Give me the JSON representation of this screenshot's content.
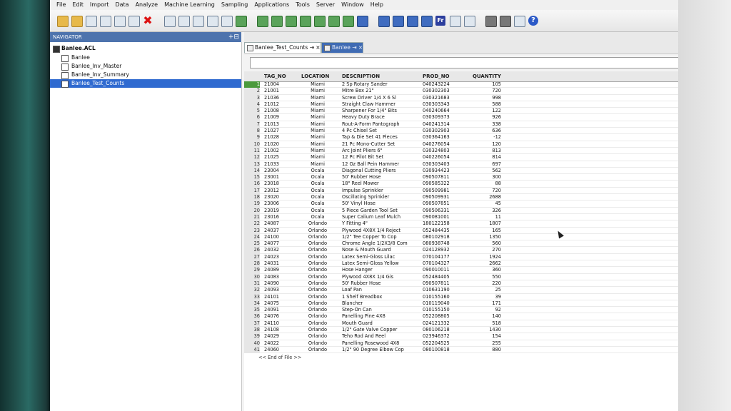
{
  "menu": [
    "File",
    "Edit",
    "Import",
    "Data",
    "Analyze",
    "Machine Learning",
    "Sampling",
    "Applications",
    "Tools",
    "Server",
    "Window",
    "Help"
  ],
  "toolbar_icons": [
    "open-folder-icon",
    "new-folder-icon",
    "cut-icon",
    "copy-icon",
    "paste-icon",
    "undo-icon",
    "delete-icon",
    "table-icon",
    "filter-icon",
    "sort-icon",
    "chart-icon",
    "statistics-icon",
    "join-icon",
    "merge-icon",
    "summarize-icon",
    "classify-icon",
    "stratify-icon",
    "age-icon",
    "histogram-icon",
    "cross-tab-icon",
    "sample-icon",
    "evaluate-icon",
    "benford-icon",
    "duplicates-icon",
    "gaps-icon",
    "fuzzy-icon",
    "export-icon",
    "report-icon",
    "print-icon",
    "print-preview-icon",
    "window-icon",
    "help-icon"
  ],
  "navigator": {
    "title": "NAVIGATOR",
    "actions": "+⊟",
    "project": "Banlee.ACL",
    "items": [
      "Banlee",
      "Banlee_Inv_Master",
      "Banlee_Inv_Summary",
      "Banlee_Test_Counts"
    ],
    "selected_index": 3
  },
  "tabs": [
    {
      "label": "Banlee_Test_Counts",
      "active": true
    },
    {
      "label": "Banlee",
      "active": false
    }
  ],
  "tab_suffix": "⇥ ×",
  "table": {
    "columns": [
      "TAG_NO",
      "LOCATION",
      "DESCRIPTION",
      "PROD_NO",
      "QUANTITY"
    ],
    "rows": [
      [
        "1",
        "21004",
        "Miami",
        "2 Sp Rotary Sander",
        "040243224",
        "105"
      ],
      [
        "2",
        "21001",
        "Miami",
        "Mitre Box 21\"",
        "030302303",
        "720"
      ],
      [
        "3",
        "21036",
        "Miami",
        "Screw Driver 1/4 X 6 Sl",
        "030321683",
        "998"
      ],
      [
        "4",
        "21012",
        "Miami",
        "Straight Claw Hammer",
        "030303343",
        "588"
      ],
      [
        "5",
        "21008",
        "Miami",
        "Sharpener For 1/4\" Bits",
        "040240664",
        "122"
      ],
      [
        "6",
        "21009",
        "Miami",
        "Heavy Duty Brace",
        "030309373",
        "926"
      ],
      [
        "7",
        "21013",
        "Miami",
        "Rout-A-Form Pantograph",
        "040241314",
        "338"
      ],
      [
        "8",
        "21027",
        "Miami",
        "4 Pc Chisel Set",
        "030302903",
        "636"
      ],
      [
        "9",
        "21028",
        "Miami",
        "Tap & Die Set 41 Pieces",
        "030364163",
        "-12"
      ],
      [
        "10",
        "21020",
        "Miami",
        "21 Pc Mono-Cutter Set",
        "040276054",
        "120"
      ],
      [
        "11",
        "21002",
        "Miami",
        "Arc Joint Pliers 6\"",
        "030324803",
        "813"
      ],
      [
        "12",
        "21025",
        "Miami",
        "12 Pc Pilot Bit Set",
        "040226054",
        "814"
      ],
      [
        "13",
        "21033",
        "Miami",
        "12 Oz Ball Pein Hammer",
        "030303403",
        "697"
      ],
      [
        "14",
        "23004",
        "Ocala",
        "Diagonal Cutting Pliers",
        "030934423",
        "562"
      ],
      [
        "15",
        "23001",
        "Ocala",
        "50' Rubber Hose",
        "090507811",
        "300"
      ],
      [
        "16",
        "23018",
        "Ocala",
        "18\" Reel Mower",
        "090585322",
        "88"
      ],
      [
        "17",
        "23012",
        "Ocala",
        "Impulse Sprinkler",
        "090509981",
        "720"
      ],
      [
        "18",
        "23020",
        "Ocala",
        "Oscillating Sprinkler",
        "090509931",
        "2688"
      ],
      [
        "19",
        "23006",
        "Ocala",
        "50' Vinyl Hose",
        "090507851",
        "45"
      ],
      [
        "20",
        "23019",
        "Ocala",
        "5 Piece Garden Tool Set",
        "090506331",
        "326"
      ],
      [
        "21",
        "23016",
        "Ocala",
        "Super Calium Leaf Mulch",
        "090081001",
        "11"
      ],
      [
        "22",
        "24087",
        "Orlando",
        "Y Fitting 4\"",
        "180122158",
        "1807"
      ],
      [
        "23",
        "24037",
        "Orlando",
        "Plywood 4X8X 1/4 Reject",
        "052484435",
        "165"
      ],
      [
        "24",
        "24100",
        "Orlando",
        "1/2\" Tee Copper To Cop",
        "080102918",
        "1350"
      ],
      [
        "25",
        "24077",
        "Orlando",
        "Chrome Angle 1/2X3/8 Com",
        "080938748",
        "560"
      ],
      [
        "26",
        "24032",
        "Orlando",
        "Nose & Mouth Guard",
        "024128932",
        "270"
      ],
      [
        "27",
        "24023",
        "Orlando",
        "Latex Semi-Gloss Lilac",
        "070104177",
        "1924"
      ],
      [
        "28",
        "24031",
        "Orlando",
        "Latex Semi-Gloss Yellow",
        "070104327",
        "2662"
      ],
      [
        "29",
        "24089",
        "Orlando",
        "Hose Hanger",
        "090010011",
        "360"
      ],
      [
        "30",
        "24083",
        "Orlando",
        "Plywood 4X8X 1/4 Gis",
        "052484405",
        "550"
      ],
      [
        "31",
        "24090",
        "Orlando",
        "50' Rubber Hose",
        "090507811",
        "220"
      ],
      [
        "32",
        "24093",
        "Orlando",
        "Loaf Pan",
        "010631190",
        "25"
      ],
      [
        "33",
        "24101",
        "Orlando",
        "1 Shelf Breadbox",
        "010155160",
        "39"
      ],
      [
        "34",
        "24075",
        "Orlando",
        "Blancher",
        "010119040",
        "171"
      ],
      [
        "35",
        "24091",
        "Orlando",
        "Step-On Can",
        "010155150",
        "92"
      ],
      [
        "36",
        "24076",
        "Orlando",
        "Panelling Pine 4X8",
        "052208805",
        "140"
      ],
      [
        "37",
        "24110",
        "Orlando",
        "Mouth Guard",
        "024121332",
        "518"
      ],
      [
        "38",
        "24108",
        "Orlando",
        "1/2\" Gate Valve Copper",
        "080106218",
        "1430"
      ],
      [
        "39",
        "24029",
        "Orlando",
        "Teho Rod And Reel",
        "023946372",
        "154"
      ],
      [
        "40",
        "24022",
        "Orlando",
        "Panelling Rosewood 4X8",
        "052204525",
        "255"
      ],
      [
        "41",
        "24060",
        "Orlando",
        "1/2\" 90 Degree Elbow Cop",
        "080100818",
        "880"
      ]
    ],
    "end_of_file": "<< End of File >>",
    "selected_row": 0
  }
}
